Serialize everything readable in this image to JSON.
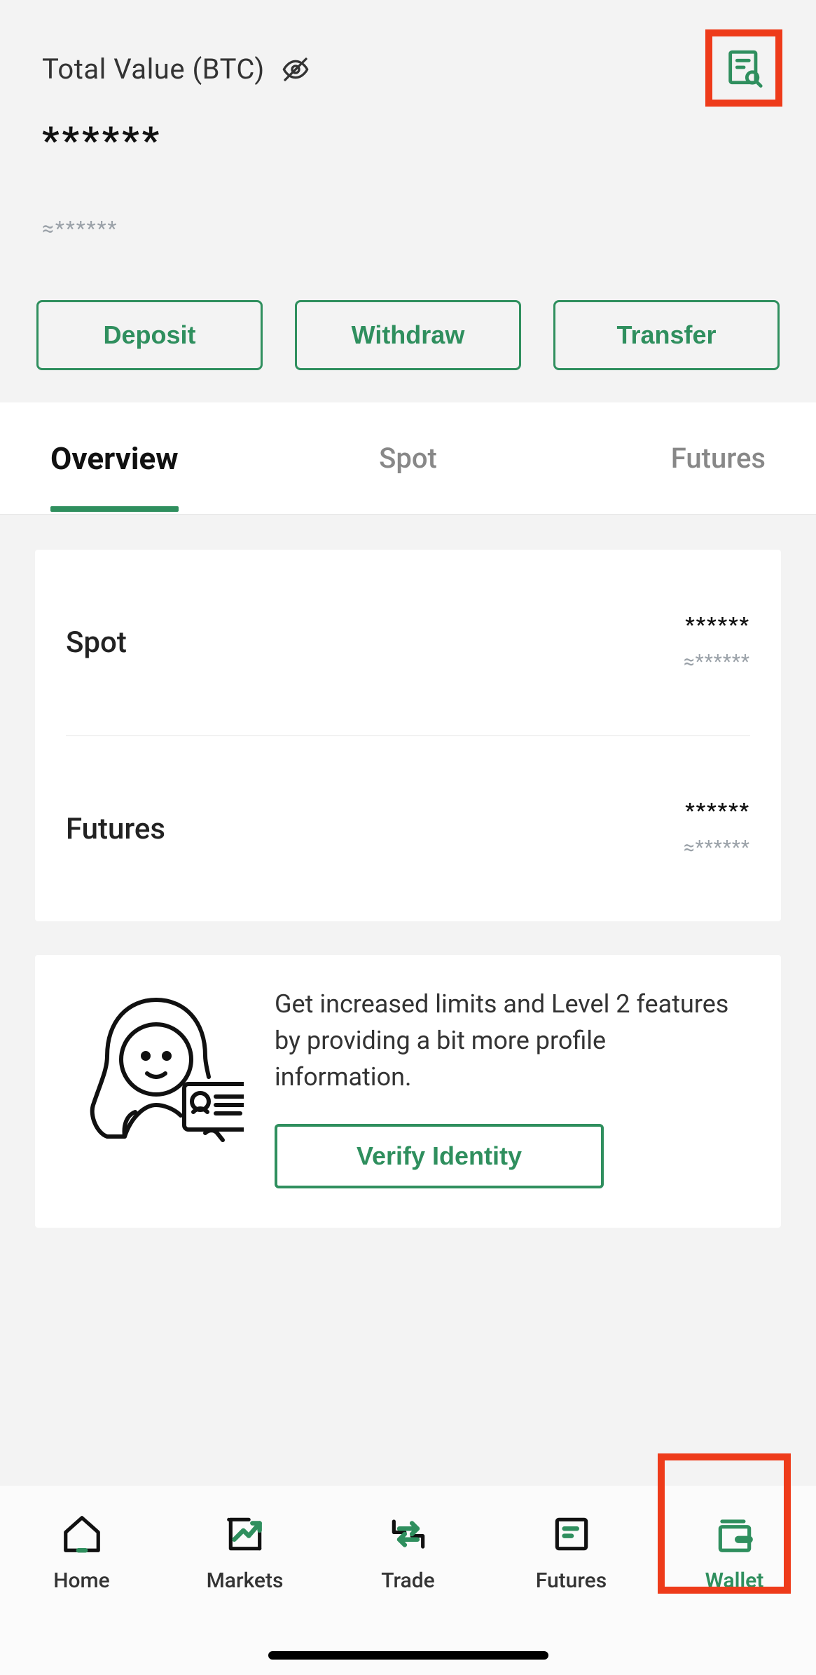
{
  "header": {
    "total_label": "Total Value (BTC)",
    "masked_value": "******",
    "masked_approx": "≈******"
  },
  "actions": {
    "deposit": "Deposit",
    "withdraw": "Withdraw",
    "transfer": "Transfer"
  },
  "tabs": {
    "overview": "Overview",
    "spot": "Spot",
    "futures": "Futures"
  },
  "balances": {
    "spot": {
      "label": "Spot",
      "value": "******",
      "approx": "≈******"
    },
    "futures": {
      "label": "Futures",
      "value": "******",
      "approx": "≈******"
    }
  },
  "verify": {
    "text": "Get increased limits and Level 2 features by providing a bit more profile information.",
    "button": "Verify Identity"
  },
  "nav": {
    "home": "Home",
    "markets": "Markets",
    "trade": "Trade",
    "futures": "Futures",
    "wallet": "Wallet"
  },
  "colors": {
    "accent": "#2f8f5e",
    "highlight": "#ee3b1a",
    "muted": "#9aa1a8"
  }
}
